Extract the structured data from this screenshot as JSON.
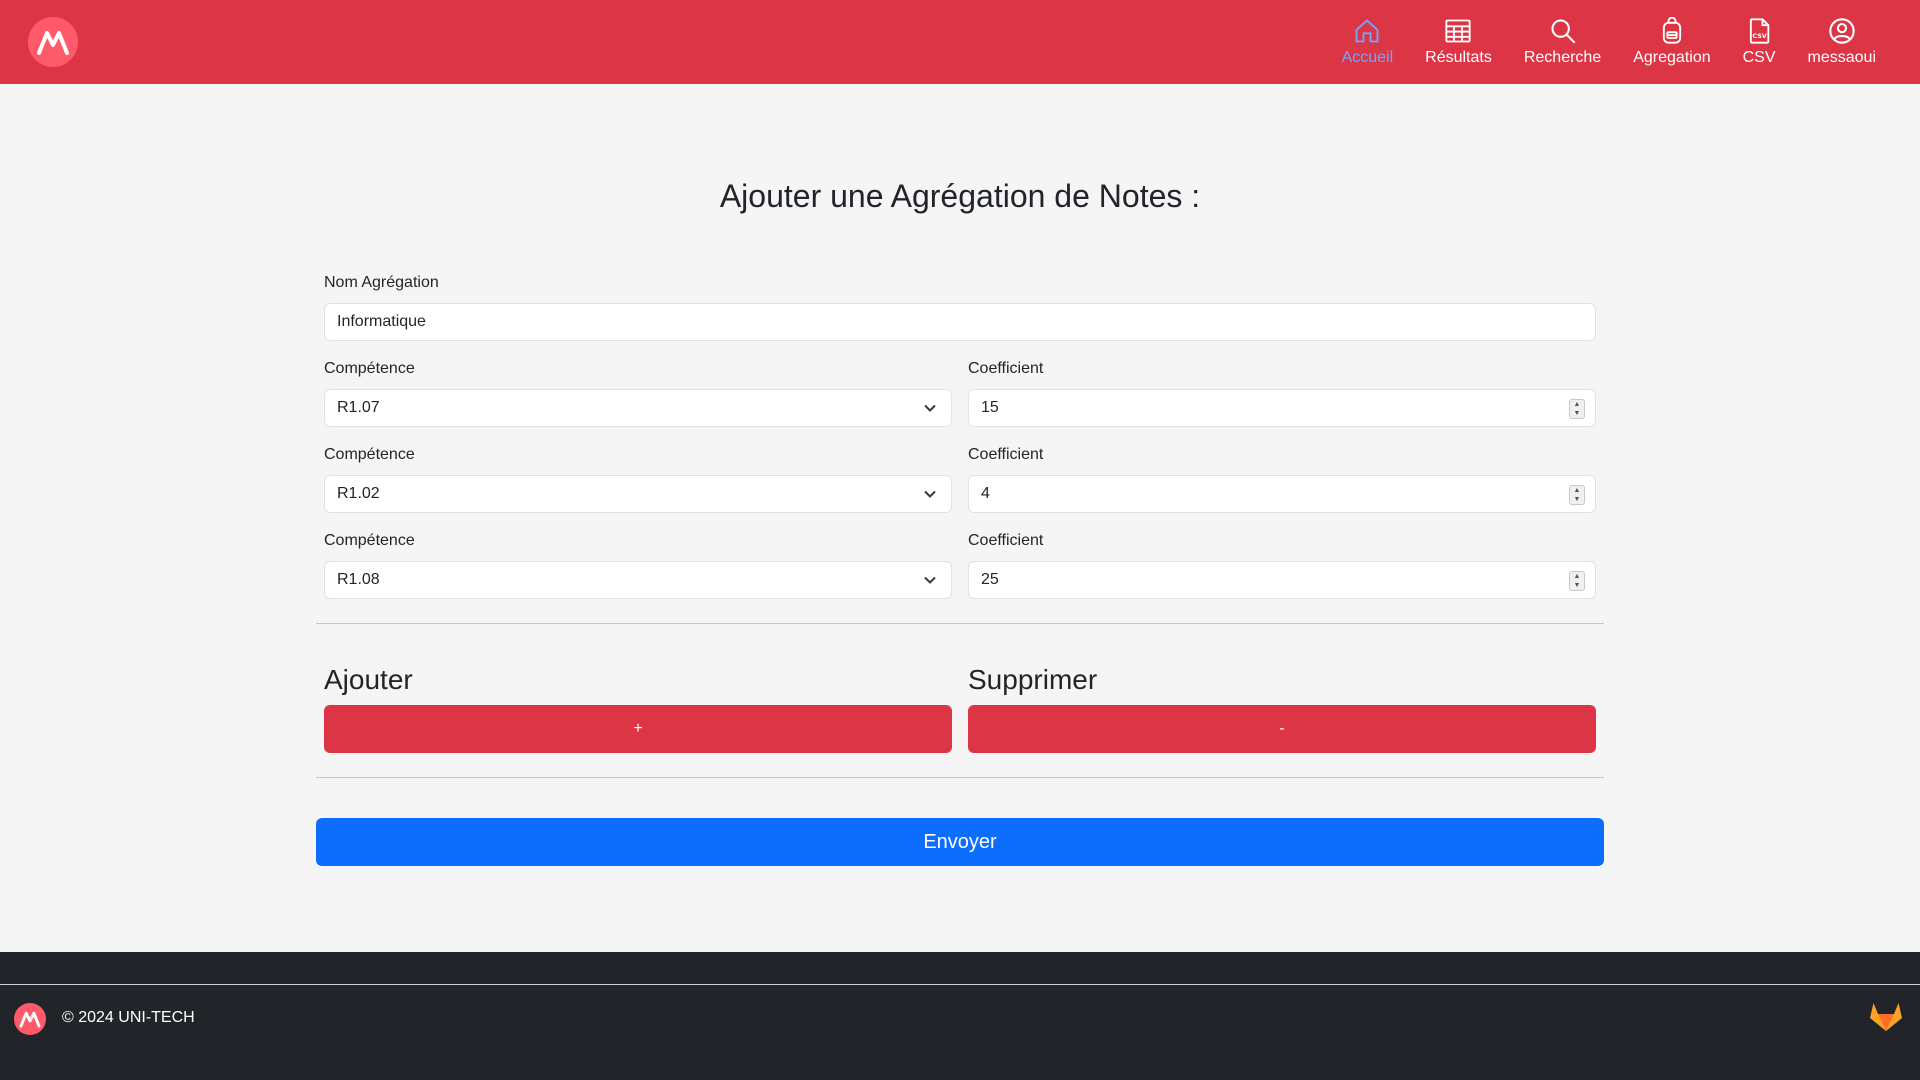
{
  "nav": {
    "items": [
      {
        "label": "Accueil",
        "icon": "home-icon",
        "active": true
      },
      {
        "label": "Résultats",
        "icon": "table-icon"
      },
      {
        "label": "Recherche",
        "icon": "search-icon"
      },
      {
        "label": "Agregation",
        "icon": "backpack-icon"
      },
      {
        "label": "CSV",
        "icon": "csv-file-icon"
      },
      {
        "label": "messaoui",
        "icon": "user-circle-icon"
      }
    ]
  },
  "form": {
    "title": "Ajouter une Agrégation de Notes :",
    "name_label": "Nom Agrégation",
    "name_value": "Informatique",
    "rows": [
      {
        "competence_label": "Compétence",
        "competence_value": "R1.07",
        "coef_label": "Coefficient",
        "coef_value": "15"
      },
      {
        "competence_label": "Compétence",
        "competence_value": "R1.02",
        "coef_label": "Coefficient",
        "coef_value": "4"
      },
      {
        "competence_label": "Compétence",
        "competence_value": "R1.08",
        "coef_label": "Coefficient",
        "coef_value": "25"
      }
    ],
    "add_heading": "Ajouter",
    "add_button": "+",
    "remove_heading": "Supprimer",
    "remove_button": "-",
    "submit": "Envoyer"
  },
  "footer": {
    "copyright": "© 2024 UNI-TECH"
  },
  "colors": {
    "brand_red": "#dc3545",
    "primary_blue": "#0d6efd",
    "footer_dark": "#212529",
    "active_nav": "#6ea8fe"
  }
}
